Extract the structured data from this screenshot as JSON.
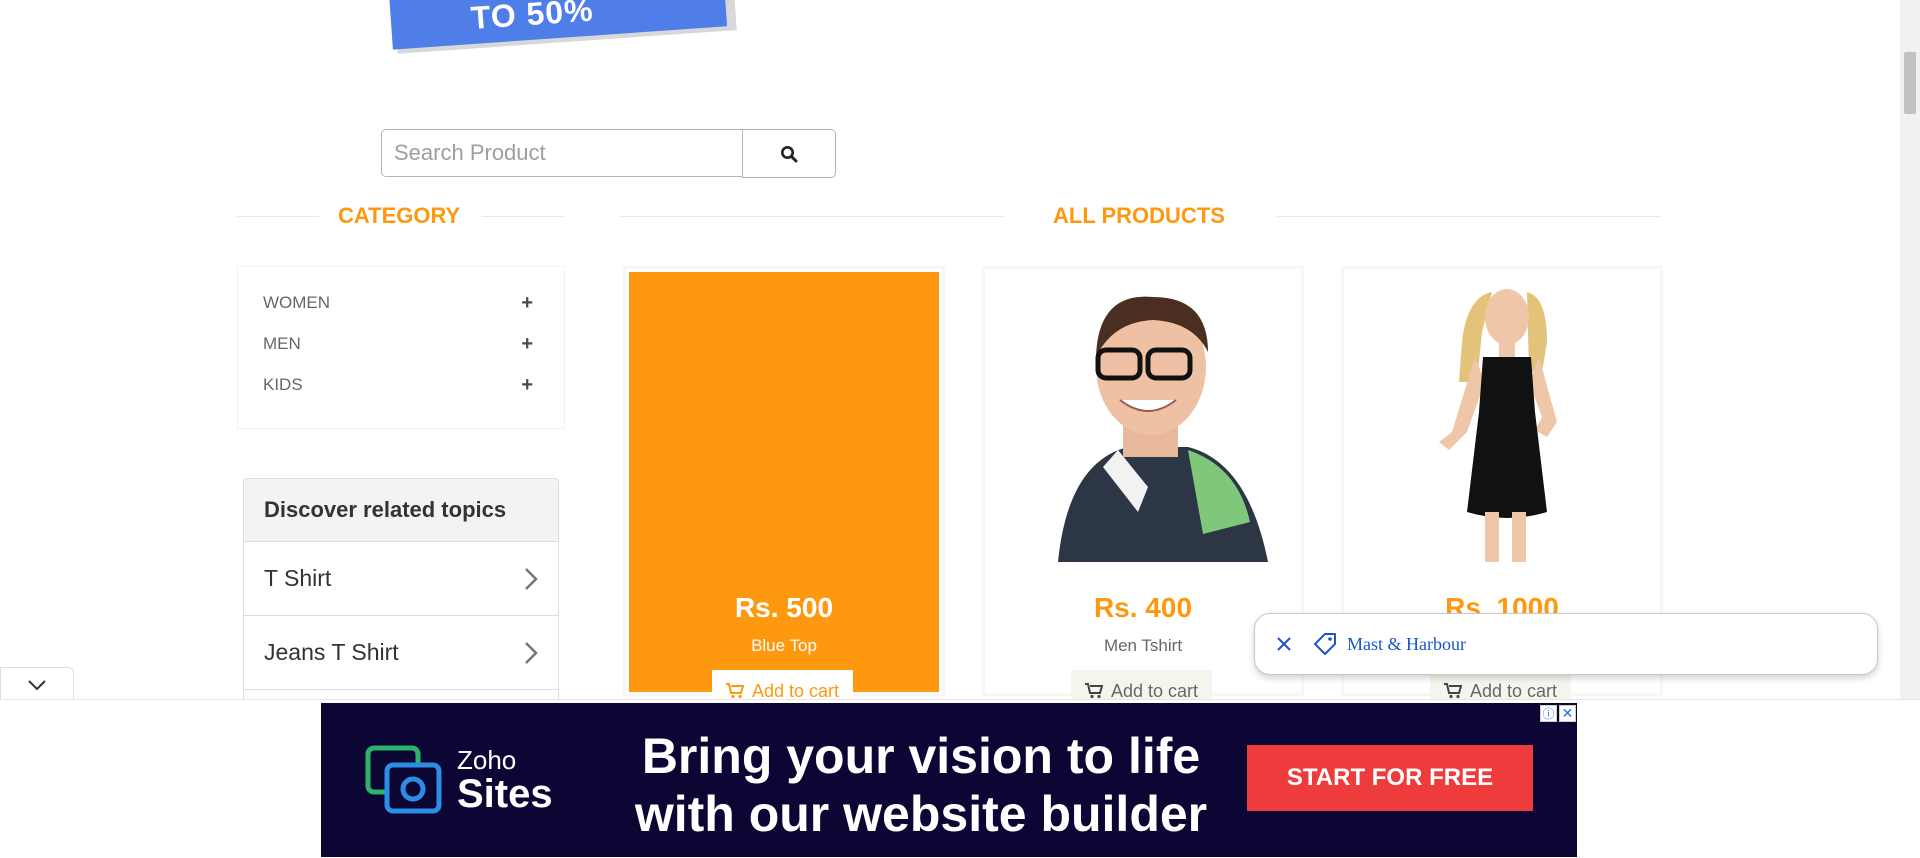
{
  "banner": {
    "text": "TO 50%"
  },
  "search": {
    "placeholder": "Search Product",
    "button_icon": "search-icon"
  },
  "category": {
    "title": "CATEGORY",
    "items": [
      {
        "label": "WOMEN",
        "icon": "plus-icon"
      },
      {
        "label": "MEN",
        "icon": "plus-icon"
      },
      {
        "label": "KIDS",
        "icon": "plus-icon"
      }
    ]
  },
  "discover": {
    "title": "Discover related topics",
    "items": [
      {
        "label": "T Shirt"
      },
      {
        "label": "Jeans T Shirt"
      }
    ]
  },
  "products": {
    "title": "ALL PRODUCTS",
    "cart_label": "Add to cart",
    "items": [
      {
        "price": "Rs. 500",
        "name": "Blue Top"
      },
      {
        "price": "Rs. 400",
        "name": "Men Tshirt"
      },
      {
        "price": "Rs. 1000",
        "name": ""
      }
    ]
  },
  "chip": {
    "text": "Mast & Harbour"
  },
  "ad": {
    "brand_line1": "Zoho",
    "brand_line2": "Sites",
    "headline_line1": "Bring your vision to life",
    "headline_line2": "with our website builder",
    "cta": "START FOR FREE",
    "info_glyph": "ⓘ",
    "close_glyph": "✕"
  },
  "colors": {
    "accent": "#fe980f",
    "ad_bg": "#0b0633",
    "ad_cta": "#ee3b3b",
    "banner": "#4f7ee8"
  }
}
